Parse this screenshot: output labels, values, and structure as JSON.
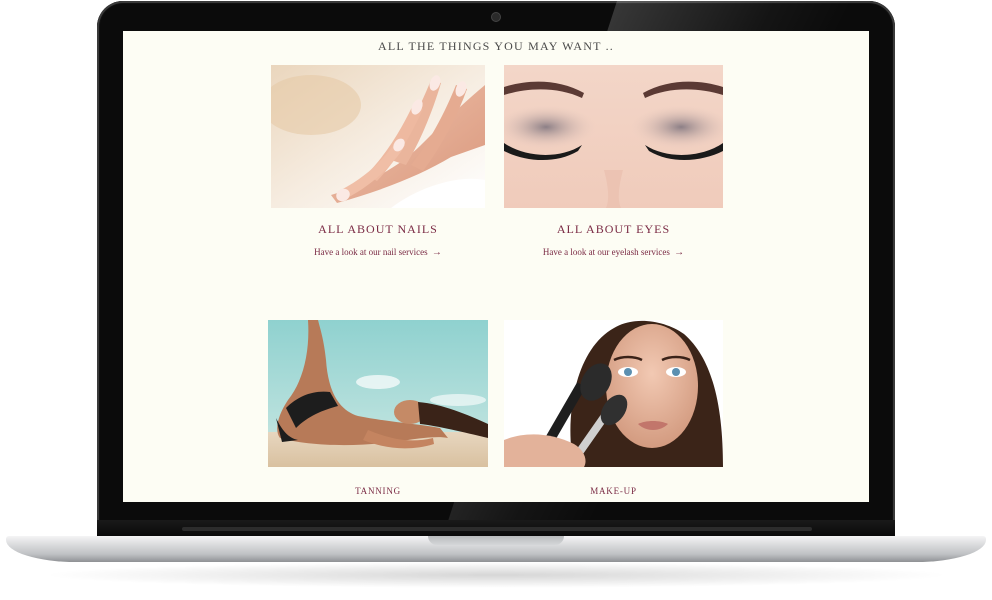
{
  "section": {
    "title": "ALL THE THINGS YOU MAY WANT .."
  },
  "cards": [
    {
      "title": "ALL ABOUT NAILS",
      "link": "Have a look at our nail services",
      "arrow": "→"
    },
    {
      "title": "ALL ABOUT EYES",
      "link": "Have a look at our eyelash services",
      "arrow": "→"
    }
  ],
  "tiles": [
    {
      "label": "TANNING"
    },
    {
      "label": "MAKE-UP"
    }
  ],
  "icons": {
    "link_arrow": "right-arrow-icon"
  },
  "colors": {
    "page_bg": "#fdfdf4",
    "accent": "#7a2a44",
    "title_text": "#4a4a4a",
    "laptop_bezel": "#0b0b0b"
  }
}
